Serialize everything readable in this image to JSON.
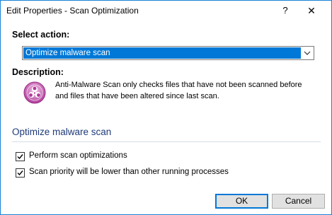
{
  "window": {
    "title": "Edit Properties - Scan Optimization",
    "help_glyph": "?",
    "close_glyph": "✕"
  },
  "select_action": {
    "label": "Select action:",
    "value": "Optimize malware scan"
  },
  "description": {
    "label": "Description:",
    "icon": "biohazard-icon",
    "text": "Anti-Malware Scan only checks files that have not been scanned before and files that have been altered since last scan."
  },
  "section": {
    "title": "Optimize malware scan"
  },
  "options": [
    {
      "label": "Perform scan optimizations",
      "checked": true
    },
    {
      "label": "Scan priority will be lower than other running processes",
      "checked": true
    }
  ],
  "buttons": {
    "ok": "OK",
    "cancel": "Cancel"
  },
  "colors": {
    "accent": "#0078d7",
    "section_title": "#1e3a78",
    "icon": "#b03a9a"
  }
}
